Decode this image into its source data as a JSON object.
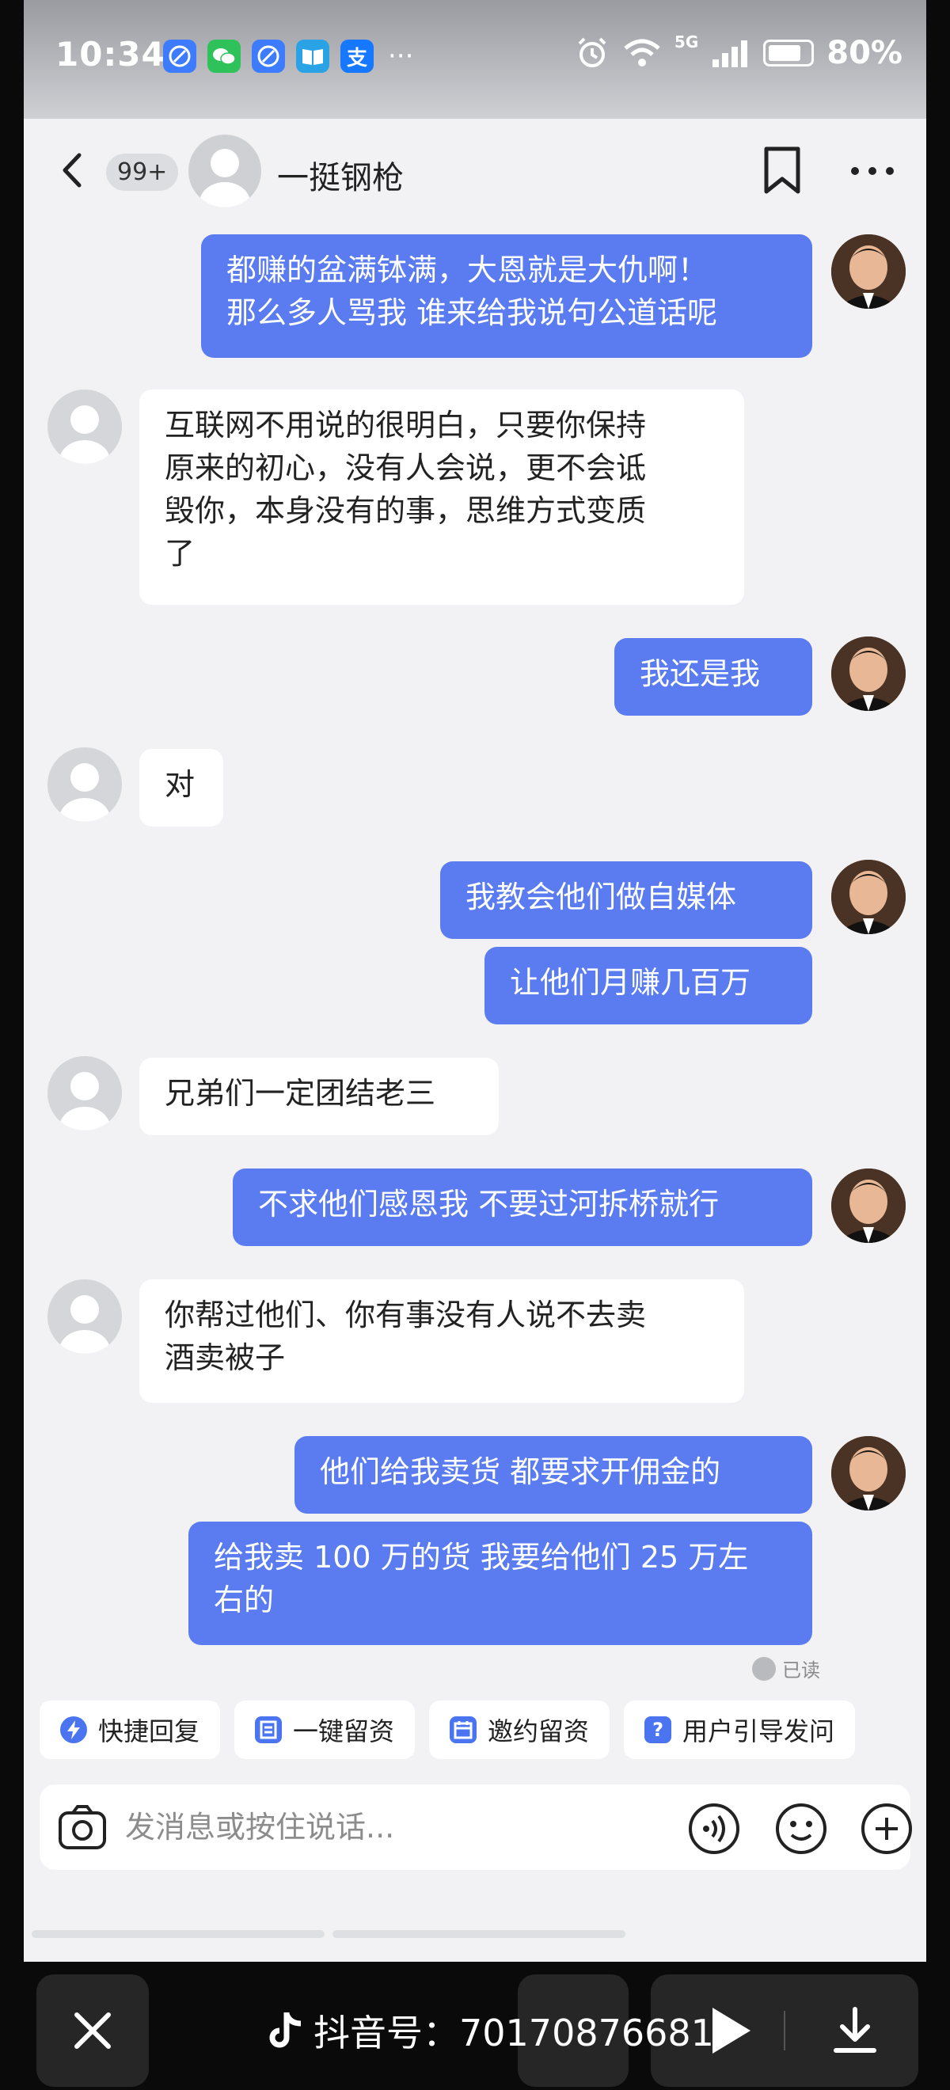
{
  "status_bar": {
    "time": "10:34",
    "battery": "80%",
    "network": "5G",
    "more": "···",
    "app_alipay_glyph": "支"
  },
  "header": {
    "unread_badge": "99+",
    "contact_name": "一挺钢枪"
  },
  "messages": [
    {
      "side": "out",
      "text": "都赚的盆满钵满，大恩就是大仇啊！\n那么多人骂我 谁来给我说句公道话呢"
    },
    {
      "side": "in",
      "text": "互联网不用说的很明白，只要你保持\n原来的初心，没有人会说，更不会诋\n毁你，本身没有的事，思维方式变质\n了"
    },
    {
      "side": "out",
      "text": "我还是我"
    },
    {
      "side": "in",
      "text": "对"
    },
    {
      "side": "out",
      "text": "我教会他们做自媒体"
    },
    {
      "side": "out",
      "text": "让他们月赚几百万"
    },
    {
      "side": "in",
      "text": "兄弟们一定团结老三"
    },
    {
      "side": "out",
      "text": "不求他们感恩我 不要过河拆桥就行"
    },
    {
      "side": "in",
      "text": "你帮过他们、你有事没有人说不去卖\n酒卖被子"
    },
    {
      "side": "out",
      "text": "他们给我卖货 都要求开佣金的"
    },
    {
      "side": "out",
      "text": "给我卖 100 万的货 我要给他们 25 万左\n右的"
    }
  ],
  "read_status": "已读",
  "quick_actions": [
    {
      "label": "快捷回复",
      "icon": "lightning-icon"
    },
    {
      "label": "一键留资",
      "icon": "form-icon"
    },
    {
      "label": "邀约留资",
      "icon": "calendar-icon"
    },
    {
      "label": "用户引导发问",
      "icon": "question-icon"
    }
  ],
  "input": {
    "placeholder": "发消息或按住说话..."
  },
  "bottom_bar": {
    "douyin_id": "抖音号：70170876681"
  },
  "colors": {
    "outgoing_bubble": "#5b7cf0",
    "incoming_bubble": "#ffffff",
    "chat_background": "#f2f2f4",
    "accent_icon": "#4a74f0"
  }
}
